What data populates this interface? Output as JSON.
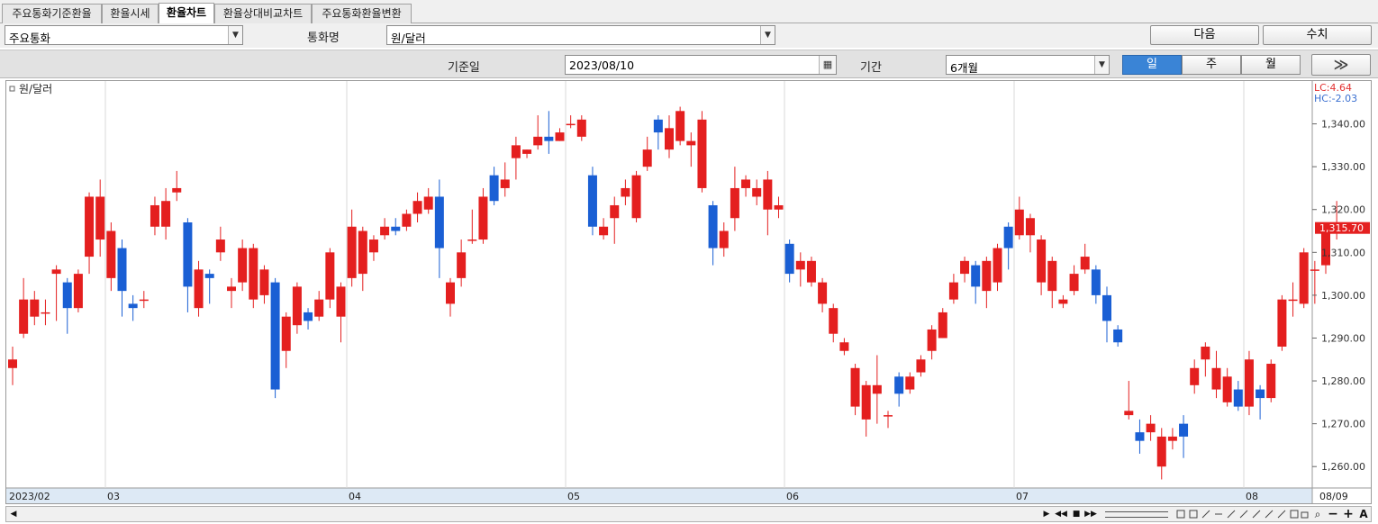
{
  "tabs": [
    {
      "label": "주요통화기준환율",
      "active": false
    },
    {
      "label": "환율시세",
      "active": false
    },
    {
      "label": "환율차트",
      "active": true
    },
    {
      "label": "환율상대비교차트",
      "active": false
    },
    {
      "label": "주요통화환율변환",
      "active": false
    }
  ],
  "toolbar": {
    "category_value": "주요통화",
    "currency_label": "통화명",
    "currency_value": "원/달러",
    "next_button": "다음",
    "values_button": "수치"
  },
  "filters": {
    "base_date_label": "기준일",
    "base_date_value": "2023/08/10",
    "period_label": "기간",
    "period_value": "6개월",
    "periods": [
      "일",
      "주",
      "월"
    ],
    "active_period": "일",
    "forward_button": "≫"
  },
  "chart_data": {
    "type": "candlestick",
    "legend": "원/달러",
    "lc_label": "LC:4.64",
    "hc_label": "HC:-2.03",
    "current_price": "1,315.70",
    "y_ticks": [
      "1,340.00",
      "1,330.00",
      "1,320.00",
      "1,310.00",
      "1,300.00",
      "1,290.00",
      "1,280.00",
      "1,270.00",
      "1,260.00"
    ],
    "ylim": [
      1255,
      1350
    ],
    "x_labels": [
      {
        "label": "2023/02",
        "index": 0
      },
      {
        "label": "03",
        "index": 9
      },
      {
        "label": "04",
        "index": 31
      },
      {
        "label": "05",
        "index": 51
      },
      {
        "label": "06",
        "index": 71
      },
      {
        "label": "07",
        "index": 92
      },
      {
        "label": "08",
        "index": 113
      }
    ],
    "last_label": "08/09",
    "candles": [
      [
        1283,
        1285,
        1279,
        1288
      ],
      [
        1291,
        1299,
        1290,
        1304
      ],
      [
        1295,
        1299,
        1293,
        1301
      ],
      [
        1296,
        1296,
        1293,
        1299
      ],
      [
        1305,
        1306,
        1294,
        1307
      ],
      [
        1303,
        1297,
        1291,
        1304
      ],
      [
        1297,
        1305,
        1296,
        1306
      ],
      [
        1309,
        1323,
        1305,
        1324
      ],
      [
        1313,
        1323,
        1309,
        1327
      ],
      [
        1304,
        1315,
        1301,
        1317
      ],
      [
        1311,
        1301,
        1295,
        1313
      ],
      [
        1298,
        1297,
        1294,
        1300
      ],
      [
        1299,
        1299,
        1297,
        1301
      ],
      [
        1316,
        1321,
        1314,
        1323
      ],
      [
        1316,
        1322,
        1313,
        1325
      ],
      [
        1324,
        1325,
        1322,
        1329
      ],
      [
        1317,
        1302,
        1296,
        1318
      ],
      [
        1297,
        1306,
        1295,
        1308
      ],
      [
        1305,
        1304,
        1298,
        1306
      ],
      [
        1310,
        1313,
        1308,
        1316
      ],
      [
        1301,
        1302,
        1297,
        1304
      ],
      [
        1303,
        1311,
        1301,
        1313
      ],
      [
        1299,
        1311,
        1297,
        1312
      ],
      [
        1300,
        1306,
        1298,
        1307
      ],
      [
        1303,
        1278,
        1276,
        1304
      ],
      [
        1287,
        1295,
        1283,
        1296
      ],
      [
        1293,
        1302,
        1291,
        1303
      ],
      [
        1296,
        1294,
        1292,
        1297
      ],
      [
        1295,
        1299,
        1294,
        1301
      ],
      [
        1299,
        1310,
        1297,
        1311
      ],
      [
        1295,
        1302,
        1289,
        1303
      ],
      [
        1304,
        1316,
        1302,
        1320
      ],
      [
        1305,
        1315,
        1301,
        1316
      ],
      [
        1310,
        1313,
        1308,
        1314
      ],
      [
        1314,
        1316,
        1313,
        1318
      ],
      [
        1316,
        1315,
        1314,
        1318
      ],
      [
        1316,
        1319,
        1315,
        1320
      ],
      [
        1319,
        1322,
        1317,
        1324
      ],
      [
        1320,
        1323,
        1319,
        1325
      ],
      [
        1323,
        1311,
        1304,
        1327
      ],
      [
        1298,
        1303,
        1295,
        1304
      ],
      [
        1304,
        1310,
        1302,
        1313
      ],
      [
        1313,
        1313,
        1312,
        1320
      ],
      [
        1313,
        1323,
        1312,
        1325
      ],
      [
        1328,
        1322,
        1321,
        1330
      ],
      [
        1325,
        1327,
        1323,
        1331
      ],
      [
        1332,
        1335,
        1327,
        1337
      ],
      [
        1333,
        1334,
        1332,
        1334
      ],
      [
        1335,
        1337,
        1334,
        1342
      ],
      [
        1337,
        1336,
        1333,
        1343
      ],
      [
        1336,
        1338,
        1336,
        1339
      ],
      [
        1340,
        1340,
        1339,
        1342
      ],
      [
        1337,
        1341,
        1336,
        1342
      ],
      [
        1328,
        1316,
        1314,
        1330
      ],
      [
        1314,
        1316,
        1313,
        1318
      ],
      [
        1318,
        1321,
        1312,
        1323
      ],
      [
        1323,
        1325,
        1321,
        1327
      ],
      [
        1318,
        1328,
        1317,
        1329
      ],
      [
        1330,
        1334,
        1329,
        1337
      ],
      [
        1341,
        1338,
        1334,
        1342
      ],
      [
        1334,
        1339,
        1332,
        1342
      ],
      [
        1336,
        1343,
        1335,
        1344
      ],
      [
        1335,
        1336,
        1330,
        1338
      ],
      [
        1325,
        1341,
        1324,
        1343
      ],
      [
        1321,
        1311,
        1307,
        1322
      ],
      [
        1311,
        1315,
        1309,
        1317
      ],
      [
        1318,
        1325,
        1315,
        1330
      ],
      [
        1325,
        1327,
        1323,
        1328
      ],
      [
        1323,
        1325,
        1321,
        1327
      ],
      [
        1320,
        1327,
        1314,
        1329
      ],
      [
        1320,
        1321,
        1318,
        1323
      ],
      [
        1312,
        1305,
        1303,
        1313
      ],
      [
        1306,
        1308,
        1302,
        1310
      ],
      [
        1303,
        1308,
        1302,
        1309
      ],
      [
        1298,
        1303,
        1296,
        1304
      ],
      [
        1291,
        1297,
        1289,
        1298
      ],
      [
        1287,
        1289,
        1286,
        1290
      ],
      [
        1274,
        1283,
        1272,
        1284
      ],
      [
        1271,
        1279,
        1267,
        1280
      ],
      [
        1277,
        1279,
        1270,
        1286
      ],
      [
        1272,
        1272,
        1269,
        1273
      ],
      [
        1281,
        1277,
        1274,
        1282
      ],
      [
        1278,
        1281,
        1277,
        1282
      ],
      [
        1282,
        1285,
        1281,
        1286
      ],
      [
        1287,
        1292,
        1285,
        1293
      ],
      [
        1290,
        1296,
        1290,
        1297
      ],
      [
        1299,
        1303,
        1298,
        1305
      ],
      [
        1305,
        1308,
        1303,
        1309
      ],
      [
        1307,
        1302,
        1298,
        1308
      ],
      [
        1301,
        1308,
        1297,
        1309
      ],
      [
        1303,
        1311,
        1301,
        1312
      ],
      [
        1316,
        1311,
        1306,
        1317
      ],
      [
        1314,
        1320,
        1313,
        1323
      ],
      [
        1314,
        1318,
        1310,
        1319
      ],
      [
        1303,
        1313,
        1300,
        1314
      ],
      [
        1301,
        1308,
        1297,
        1309
      ],
      [
        1298,
        1299,
        1297,
        1300
      ],
      [
        1301,
        1305,
        1300,
        1307
      ],
      [
        1306,
        1309,
        1305,
        1312
      ],
      [
        1306,
        1300,
        1298,
        1307
      ],
      [
        1300,
        1294,
        1289,
        1302
      ],
      [
        1292,
        1289,
        1288,
        1293
      ],
      [
        1272,
        1273,
        1271,
        1280
      ],
      [
        1268,
        1266,
        1263,
        1271
      ],
      [
        1268,
        1270,
        1266,
        1272
      ],
      [
        1260,
        1267,
        1257,
        1269
      ],
      [
        1266,
        1267,
        1264,
        1269
      ],
      [
        1270,
        1267,
        1262,
        1272
      ],
      [
        1279,
        1283,
        1277,
        1285
      ],
      [
        1285,
        1288,
        1281,
        1289
      ],
      [
        1278,
        1283,
        1276,
        1287
      ],
      [
        1275,
        1281,
        1274,
        1283
      ],
      [
        1278,
        1274,
        1273,
        1280
      ],
      [
        1274,
        1285,
        1272,
        1287
      ],
      [
        1278,
        1276,
        1271,
        1279
      ],
      [
        1276,
        1284,
        1275,
        1285
      ],
      [
        1288,
        1299,
        1287,
        1300
      ],
      [
        1299,
        1299,
        1295,
        1303
      ],
      [
        1298,
        1310,
        1297,
        1311
      ],
      [
        1306,
        1306,
        1298,
        1308
      ],
      [
        1307,
        1315,
        1305,
        1316
      ],
      [
        1315,
        1317,
        1313,
        1322
      ]
    ]
  },
  "scroll": {
    "left_arrow": "◀",
    "right_arrow": "▶",
    "controls": [
      "◀◀",
      "■",
      "▶▶"
    ],
    "zoom_minus": "−",
    "zoom_plus": "+",
    "search": "⌕",
    "auto": "A"
  }
}
